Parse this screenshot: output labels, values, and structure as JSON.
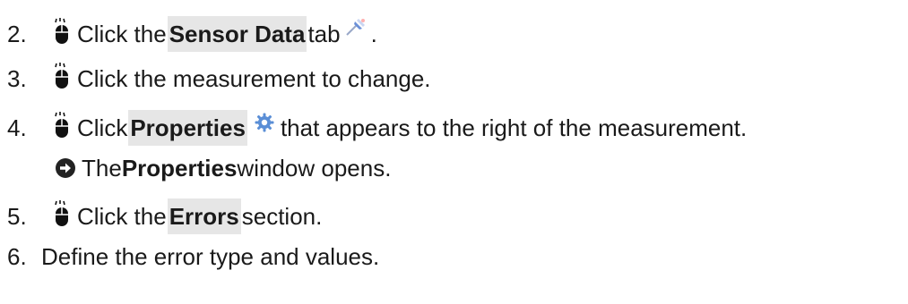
{
  "steps": [
    {
      "number": "2.",
      "click_icon": "mouse-click-icon",
      "text_before": "Click the ",
      "highlight": "Sensor Data",
      "text_after": " tab",
      "trailing_icon": "sensor-data-tab-icon",
      "end": "."
    },
    {
      "number": "3.",
      "click_icon": "mouse-click-icon",
      "text": "Click the measurement to change."
    },
    {
      "number": "4.",
      "click_icon": "mouse-click-icon",
      "text_before": "Click ",
      "highlight": "Properties",
      "inline_icon": "gear-icon",
      "text_after": "that appears to the right of the measurement."
    },
    {
      "result_icon": "arrow-right-circle-icon",
      "text_before": "The ",
      "bold": "Properties",
      "text_after": " window opens."
    },
    {
      "number": "5.",
      "click_icon": "mouse-click-icon",
      "text_before": "Click the ",
      "highlight": "Errors",
      "text_after": " section."
    },
    {
      "number": "6.",
      "text": "Define the error type and values."
    }
  ]
}
